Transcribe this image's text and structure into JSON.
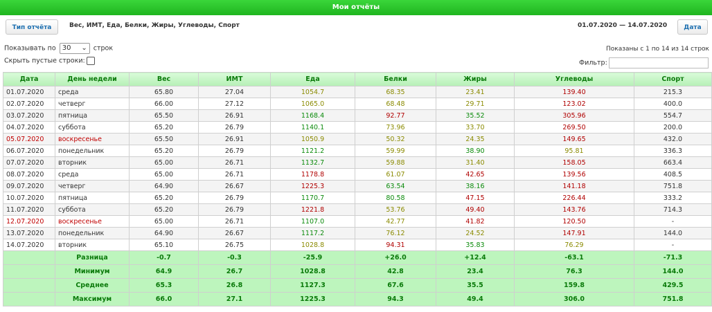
{
  "header": {
    "title": "Мои отчёты"
  },
  "toolbar": {
    "report_type_button": "Тип отчёта",
    "report_type_value": "Вес, ИМТ, Еда, Белки, Жиры, Углеводы, Спорт",
    "date_range": "01.07.2020 — 14.07.2020",
    "date_button": "Дата"
  },
  "controls": {
    "show_prefix": "Показывать по",
    "page_size": "30",
    "show_suffix": "строк",
    "hide_empty_label": "Скрыть пустые строки:",
    "shown_info": "Показаны с 1 по 14 из 14 строк",
    "filter_label": "Фильтр:"
  },
  "table": {
    "columns": [
      "Дата",
      "День недели",
      "Вес",
      "ИМТ",
      "Еда",
      "Белки",
      "Жиры",
      "Углеводы",
      "Спорт"
    ],
    "rows": [
      {
        "date": "01.07.2020",
        "day": "среда",
        "weekend": false,
        "ves": "65.80",
        "imt": "27.04",
        "eda": "1054.7",
        "eda_c": "co",
        "belki": "68.35",
        "belki_c": "co",
        "zhiry": "23.41",
        "zhiry_c": "co",
        "ugl": "139.40",
        "ugl_c": "cr",
        "sport": "215.3"
      },
      {
        "date": "02.07.2020",
        "day": "четверг",
        "weekend": false,
        "ves": "66.00",
        "imt": "27.12",
        "eda": "1065.0",
        "eda_c": "co",
        "belki": "68.48",
        "belki_c": "co",
        "zhiry": "29.71",
        "zhiry_c": "co",
        "ugl": "123.02",
        "ugl_c": "cr",
        "sport": "400.0"
      },
      {
        "date": "03.07.2020",
        "day": "пятница",
        "weekend": false,
        "ves": "65.50",
        "imt": "26.91",
        "eda": "1168.4",
        "eda_c": "cg",
        "belki": "92.77",
        "belki_c": "cr",
        "zhiry": "35.52",
        "zhiry_c": "cg",
        "ugl": "305.96",
        "ugl_c": "cr",
        "sport": "554.7"
      },
      {
        "date": "04.07.2020",
        "day": "суббота",
        "weekend": false,
        "ves": "65.20",
        "imt": "26.79",
        "eda": "1140.1",
        "eda_c": "cg",
        "belki": "73.96",
        "belki_c": "co",
        "zhiry": "33.70",
        "zhiry_c": "co",
        "ugl": "269.50",
        "ugl_c": "cr",
        "sport": "200.0"
      },
      {
        "date": "05.07.2020",
        "day": "воскресенье",
        "weekend": true,
        "ves": "65.50",
        "imt": "26.91",
        "eda": "1050.9",
        "eda_c": "co",
        "belki": "50.32",
        "belki_c": "co",
        "zhiry": "24.35",
        "zhiry_c": "co",
        "ugl": "149.65",
        "ugl_c": "cr",
        "sport": "432.0"
      },
      {
        "date": "06.07.2020",
        "day": "понедельник",
        "weekend": false,
        "ves": "65.20",
        "imt": "26.79",
        "eda": "1121.2",
        "eda_c": "cg",
        "belki": "59.99",
        "belki_c": "co",
        "zhiry": "38.90",
        "zhiry_c": "cg",
        "ugl": "95.81",
        "ugl_c": "co",
        "sport": "336.3"
      },
      {
        "date": "07.07.2020",
        "day": "вторник",
        "weekend": false,
        "ves": "65.00",
        "imt": "26.71",
        "eda": "1132.7",
        "eda_c": "cg",
        "belki": "59.88",
        "belki_c": "co",
        "zhiry": "31.40",
        "zhiry_c": "co",
        "ugl": "158.05",
        "ugl_c": "cr",
        "sport": "663.4"
      },
      {
        "date": "08.07.2020",
        "day": "среда",
        "weekend": false,
        "ves": "65.00",
        "imt": "26.71",
        "eda": "1178.8",
        "eda_c": "cr",
        "belki": "61.07",
        "belki_c": "co",
        "zhiry": "42.65",
        "zhiry_c": "cr",
        "ugl": "139.56",
        "ugl_c": "cr",
        "sport": "408.5"
      },
      {
        "date": "09.07.2020",
        "day": "четверг",
        "weekend": false,
        "ves": "64.90",
        "imt": "26.67",
        "eda": "1225.3",
        "eda_c": "cr",
        "belki": "63.54",
        "belki_c": "cg",
        "zhiry": "38.16",
        "zhiry_c": "cg",
        "ugl": "141.18",
        "ugl_c": "cr",
        "sport": "751.8"
      },
      {
        "date": "10.07.2020",
        "day": "пятница",
        "weekend": false,
        "ves": "65.20",
        "imt": "26.79",
        "eda": "1170.7",
        "eda_c": "cg",
        "belki": "80.58",
        "belki_c": "cg",
        "zhiry": "47.15",
        "zhiry_c": "cr",
        "ugl": "226.44",
        "ugl_c": "cr",
        "sport": "333.2"
      },
      {
        "date": "11.07.2020",
        "day": "суббота",
        "weekend": false,
        "ves": "65.20",
        "imt": "26.79",
        "eda": "1221.8",
        "eda_c": "cr",
        "belki": "53.76",
        "belki_c": "co",
        "zhiry": "49.40",
        "zhiry_c": "cr",
        "ugl": "143.76",
        "ugl_c": "cr",
        "sport": "714.3"
      },
      {
        "date": "12.07.2020",
        "day": "воскресенье",
        "weekend": true,
        "ves": "65.00",
        "imt": "26.71",
        "eda": "1107.0",
        "eda_c": "cg",
        "belki": "42.77",
        "belki_c": "co",
        "zhiry": "41.82",
        "zhiry_c": "cr",
        "ugl": "120.50",
        "ugl_c": "cr",
        "sport": "-"
      },
      {
        "date": "13.07.2020",
        "day": "понедельник",
        "weekend": false,
        "ves": "64.90",
        "imt": "26.67",
        "eda": "1117.2",
        "eda_c": "cg",
        "belki": "76.12",
        "belki_c": "co",
        "zhiry": "24.52",
        "zhiry_c": "co",
        "ugl": "147.91",
        "ugl_c": "cr",
        "sport": "144.0"
      },
      {
        "date": "14.07.2020",
        "day": "вторник",
        "weekend": false,
        "ves": "65.10",
        "imt": "26.75",
        "eda": "1028.8",
        "eda_c": "co",
        "belki": "94.31",
        "belki_c": "cr",
        "zhiry": "35.83",
        "zhiry_c": "cg",
        "ugl": "76.29",
        "ugl_c": "co",
        "sport": "-"
      }
    ],
    "summary": [
      {
        "label": "Разница",
        "ves": "-0.7",
        "imt": "-0.3",
        "eda": "-25.9",
        "belki": "+26.0",
        "zhiry": "+12.4",
        "ugl": "-63.1",
        "sport": "-71.3"
      },
      {
        "label": "Минимум",
        "ves": "64.9",
        "imt": "26.7",
        "eda": "1028.8",
        "belki": "42.8",
        "zhiry": "23.4",
        "ugl": "76.3",
        "sport": "144.0"
      },
      {
        "label": "Среднее",
        "ves": "65.3",
        "imt": "26.8",
        "eda": "1127.3",
        "belki": "67.6",
        "zhiry": "35.5",
        "ugl": "159.8",
        "sport": "429.5"
      },
      {
        "label": "Максимум",
        "ves": "66.0",
        "imt": "27.1",
        "eda": "1225.3",
        "belki": "94.3",
        "zhiry": "49.4",
        "ugl": "306.0",
        "sport": "751.8"
      }
    ]
  },
  "colors": {
    "header_green": "#1fb51f",
    "good": "#0a8a0a",
    "warn": "#8a8a00",
    "bad": "#b00000",
    "weekend": "#c00000"
  }
}
